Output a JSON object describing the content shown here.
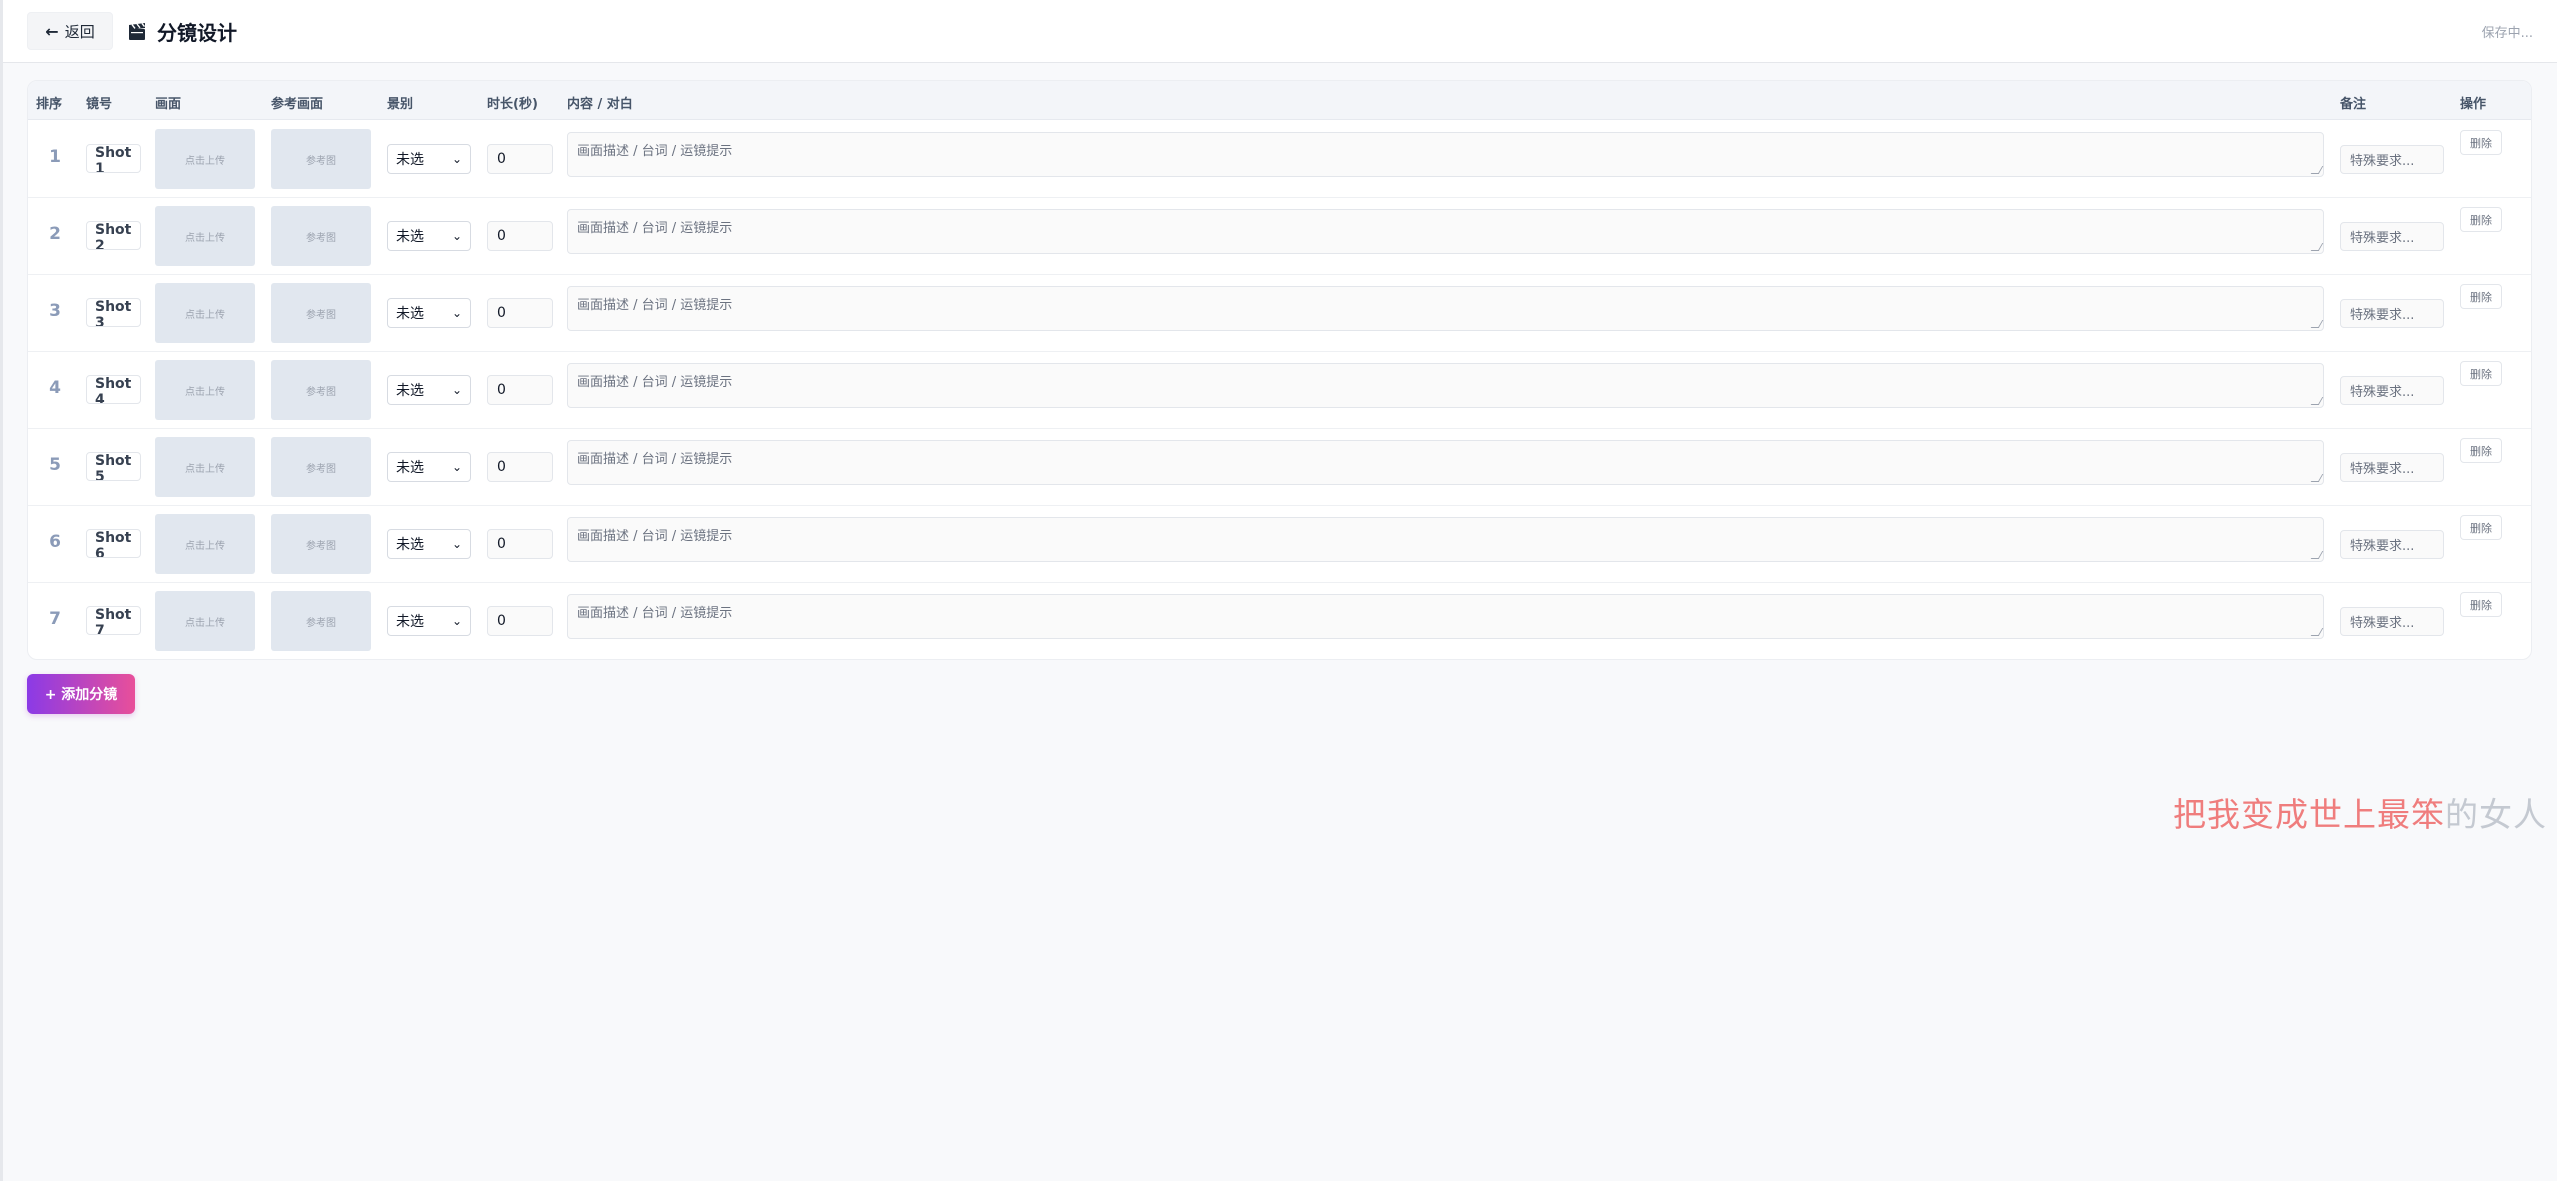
{
  "header": {
    "back_label": "返回",
    "title": "分镜设计",
    "save_status": "保存中..."
  },
  "table": {
    "columns": [
      "排序",
      "镜号",
      "画面",
      "参考画面",
      "景别",
      "时长(秒)",
      "内容 / 对白",
      "备注",
      "操作"
    ],
    "rows": [
      {
        "seq": "1",
        "shot": "Shot 1",
        "upload_label": "点击上传",
        "ref_label": "参考图",
        "scene": "未选",
        "duration": "0",
        "content_placeholder": "画面描述 / 台词 / 运镜提示",
        "note_placeholder": "特殊要求...",
        "delete_label": "删除"
      },
      {
        "seq": "2",
        "shot": "Shot 2",
        "upload_label": "点击上传",
        "ref_label": "参考图",
        "scene": "未选",
        "duration": "0",
        "content_placeholder": "画面描述 / 台词 / 运镜提示",
        "note_placeholder": "特殊要求...",
        "delete_label": "删除"
      },
      {
        "seq": "3",
        "shot": "Shot 3",
        "upload_label": "点击上传",
        "ref_label": "参考图",
        "scene": "未选",
        "duration": "0",
        "content_placeholder": "画面描述 / 台词 / 运镜提示",
        "note_placeholder": "特殊要求...",
        "delete_label": "删除"
      },
      {
        "seq": "4",
        "shot": "Shot 4",
        "upload_label": "点击上传",
        "ref_label": "参考图",
        "scene": "未选",
        "duration": "0",
        "content_placeholder": "画面描述 / 台词 / 运镜提示",
        "note_placeholder": "特殊要求...",
        "delete_label": "删除"
      },
      {
        "seq": "5",
        "shot": "Shot 5",
        "upload_label": "点击上传",
        "ref_label": "参考图",
        "scene": "未选",
        "duration": "0",
        "content_placeholder": "画面描述 / 台词 / 运镜提示",
        "note_placeholder": "特殊要求...",
        "delete_label": "删除"
      },
      {
        "seq": "6",
        "shot": "Shot 6",
        "upload_label": "点击上传",
        "ref_label": "参考图",
        "scene": "未选",
        "duration": "0",
        "content_placeholder": "画面描述 / 台词 / 运镜提示",
        "note_placeholder": "特殊要求...",
        "delete_label": "删除"
      },
      {
        "seq": "7",
        "shot": "Shot 7",
        "upload_label": "点击上传",
        "ref_label": "参考图",
        "scene": "未选",
        "duration": "0",
        "content_placeholder": "画面描述 / 台词 / 运镜提示",
        "note_placeholder": "特殊要求...",
        "delete_label": "删除"
      }
    ]
  },
  "add_button_label": "+ 添加分镜",
  "overlay_text": {
    "highlighted": "把我变成世上最笨",
    "rest": "的女人"
  },
  "colors": {
    "accent_start": "#8b3ae6",
    "accent_end": "#e84f9a",
    "overlay_highlight": "#ef7d7d"
  },
  "icons": {
    "back": "arrow-left-icon",
    "title": "clapperboard-icon",
    "select": "chevron-down-icon"
  }
}
